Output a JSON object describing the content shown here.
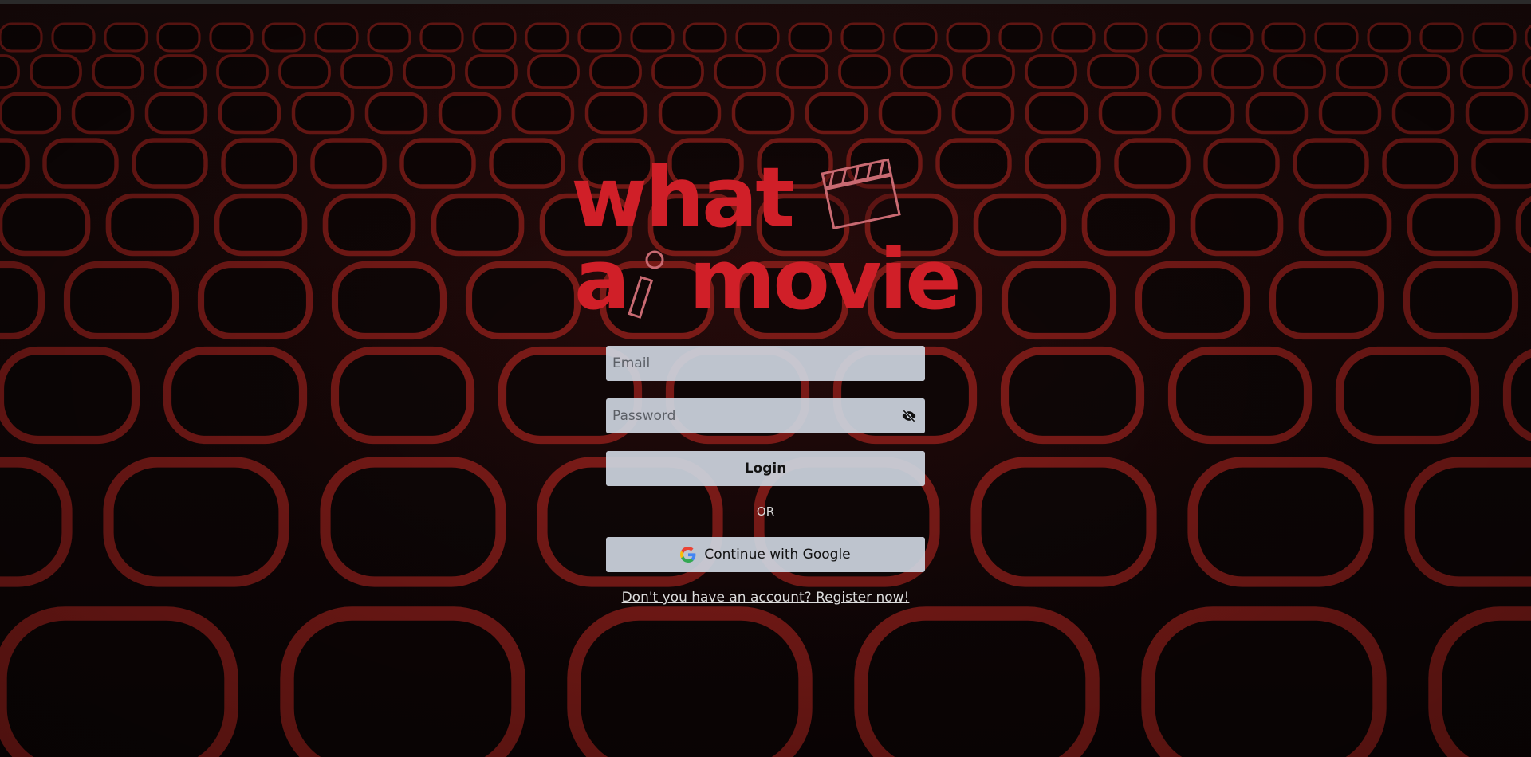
{
  "app": {
    "logo_line1": "what",
    "logo_line2_a": "a",
    "logo_line2_b": "movie",
    "brand_color": "#d01f28"
  },
  "form": {
    "email_placeholder": "Email",
    "email_value": "",
    "password_placeholder": "Password",
    "password_value": "",
    "password_toggle_icon": "eye-slash-icon",
    "login_label": "Login",
    "or_label": "OR",
    "google_label": "Continue with Google",
    "google_icon": "google-icon",
    "register_link": "Don't you have an account? Register now!"
  },
  "background": {
    "description_icon": "cinema-seats-background"
  }
}
